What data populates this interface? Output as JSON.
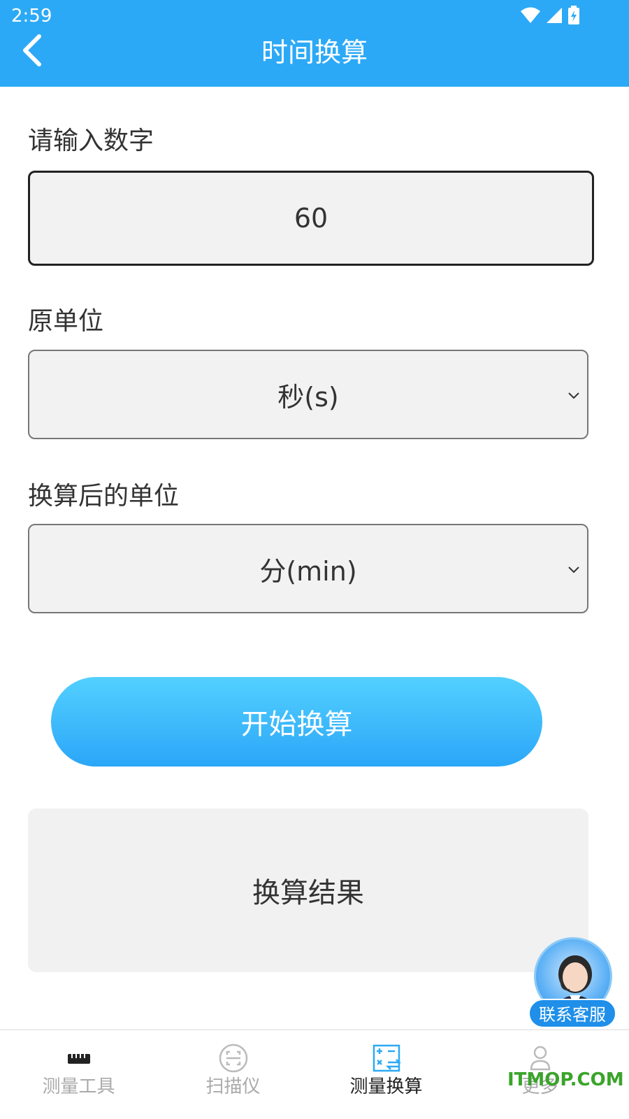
{
  "status_bar": {
    "time": "2:59"
  },
  "header": {
    "title": "时间换算"
  },
  "form": {
    "input_label": "请输入数字",
    "input_value": "60",
    "from_label": "原单位",
    "from_value": "秒(s)",
    "to_label": "换算后的单位",
    "to_value": "分(min)",
    "convert_label": "开始换算",
    "result_text": "换算结果"
  },
  "customer_service": {
    "label": "联系客服"
  },
  "nav": {
    "items": [
      {
        "label": "测量工具",
        "icon": "ruler-icon"
      },
      {
        "label": "扫描仪",
        "icon": "scanner-icon"
      },
      {
        "label": "测量换算",
        "icon": "calculator-icon"
      },
      {
        "label": "更多",
        "icon": "user-icon"
      }
    ],
    "active_index": 2
  },
  "watermark": "ITMOP.COM",
  "colors": {
    "primary": "#2ca9f6",
    "button_top": "#53d0ff",
    "button_bottom": "#2ba6f8",
    "watermark": "#3aa42a"
  }
}
